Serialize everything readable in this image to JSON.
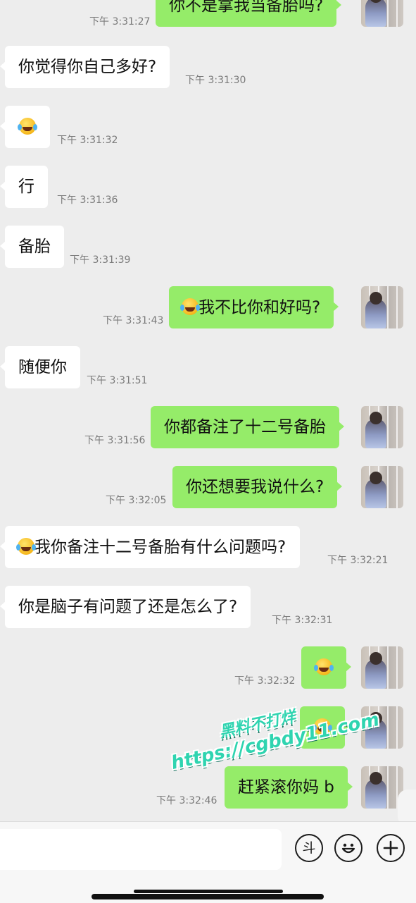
{
  "messages": [
    {
      "side": "out",
      "text": "你不是拿我当备胎吗?",
      "time": "下午 3:31:27"
    },
    {
      "side": "in",
      "text": "你觉得你自己多好?",
      "time": "下午 3:31:30"
    },
    {
      "side": "in",
      "emoji": "laughing-tears-emoji",
      "text": "",
      "time": "下午 3:31:32"
    },
    {
      "side": "in",
      "text": "行",
      "time": "下午 3:31:36"
    },
    {
      "side": "in",
      "text": "备胎",
      "time": "下午 3:31:39"
    },
    {
      "side": "out",
      "emoji": "laughing-tears-emoji",
      "text": "我不比你和好吗?",
      "time": "下午 3:31:43"
    },
    {
      "side": "in",
      "text": "随便你",
      "time": "下午 3:31:51"
    },
    {
      "side": "out",
      "text": "你都备注了十二号备胎",
      "time": "下午 3:31:56"
    },
    {
      "side": "out",
      "text": "你还想要我说什么?",
      "time": "下午 3:32:05"
    },
    {
      "side": "in",
      "emoji": "laughing-tears-emoji",
      "text": "我你备注十二号备胎有什么问题吗?",
      "time": "下午 3:32:21"
    },
    {
      "side": "in",
      "text": "你是脑子有问题了还是怎么了?",
      "time": "下午 3:32:31"
    },
    {
      "side": "out",
      "emoji": "laughing-tears-emoji",
      "text": "",
      "time": "下午 3:32:32"
    },
    {
      "side": "out",
      "emoji": "laughing-tears-emoji",
      "text": "",
      "time": ""
    },
    {
      "side": "out",
      "text": "赶紧滚你妈 b",
      "time": "下午 3:32:46"
    }
  ],
  "watermark": {
    "line1": "黑料不打烊",
    "line2": "https://cgbdy11.com"
  },
  "toolbar": {
    "voice_icon": "斗",
    "emoji_icon": "smiley-icon",
    "plus_icon": "plus-icon"
  },
  "colors": {
    "background": "#ededed",
    "incoming_bubble": "#ffffff",
    "outgoing_bubble": "#95ec69",
    "timestamp": "#7a7a7a",
    "watermark": "#2fd4b0"
  }
}
